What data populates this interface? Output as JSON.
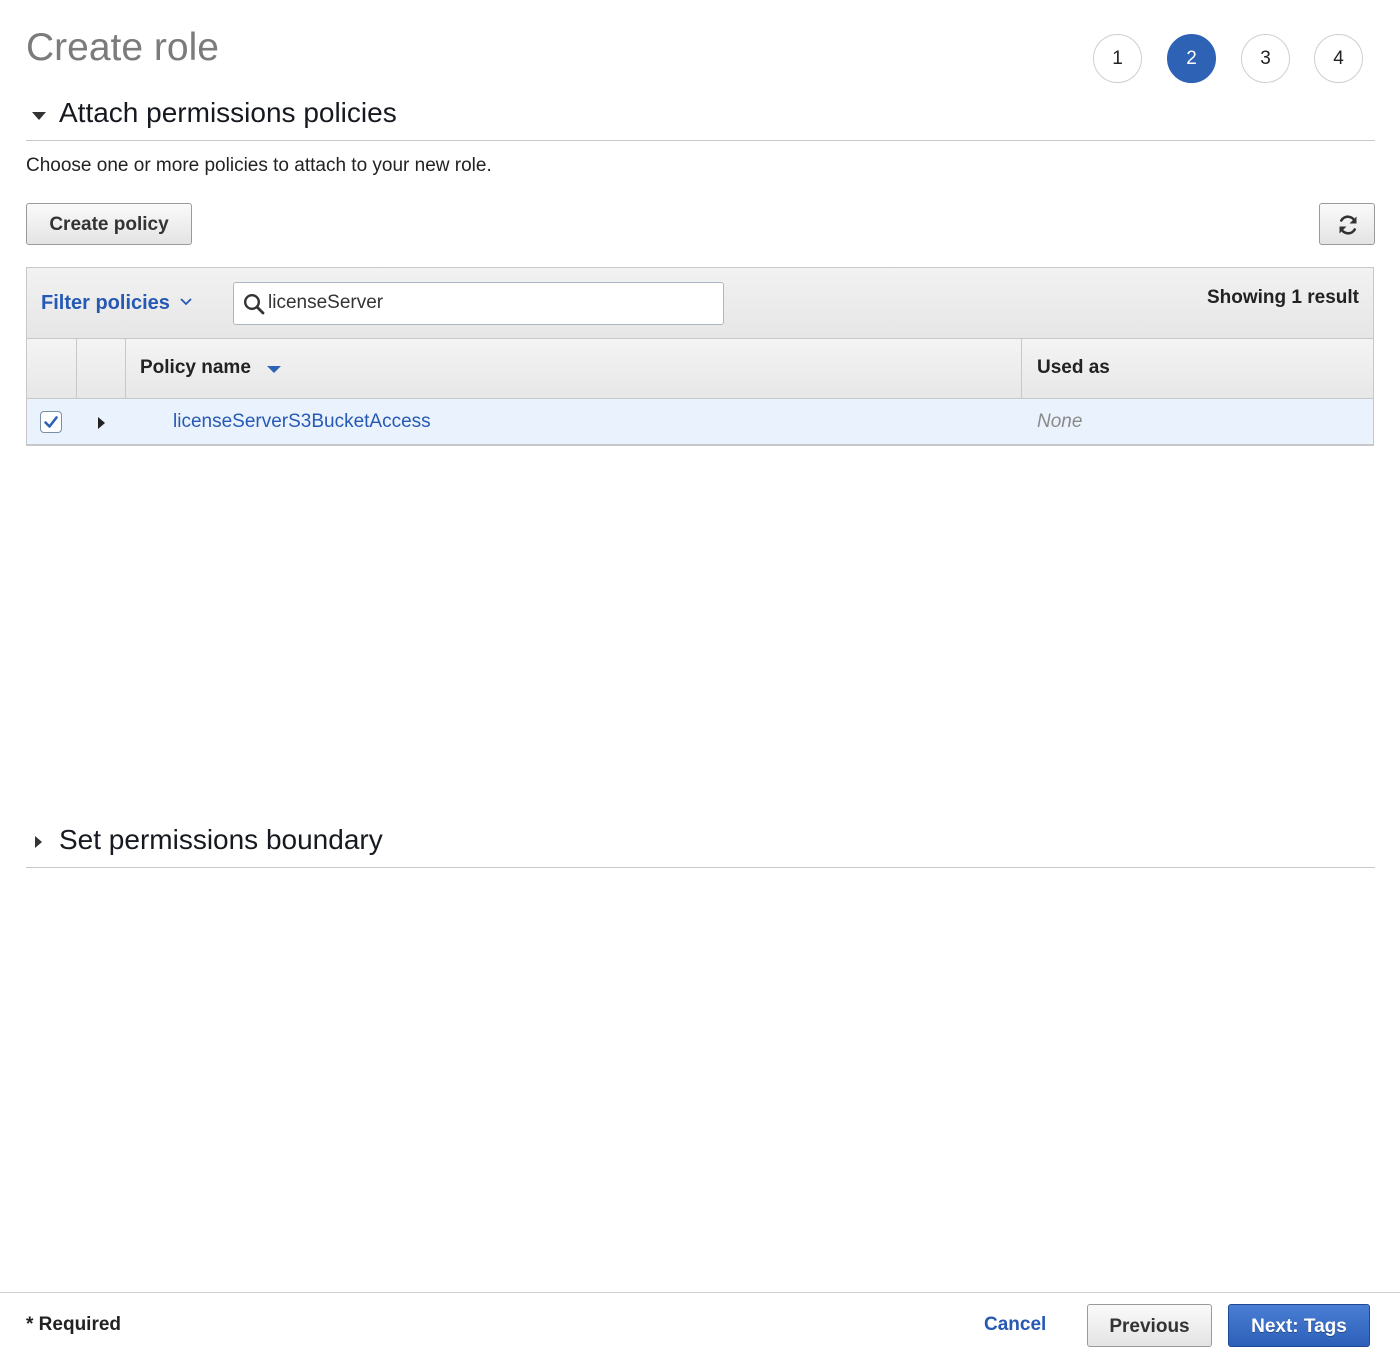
{
  "page": {
    "title": "Create role"
  },
  "steps": [
    "1",
    "2",
    "3",
    "4"
  ],
  "active_step": "2",
  "sections": {
    "attach": {
      "title": "Attach permissions policies",
      "expanded": true
    },
    "boundary": {
      "title": "Set permissions boundary",
      "expanded": false
    }
  },
  "description": "Choose one or more policies to attach to your new role.",
  "buttons": {
    "create_policy": "Create policy"
  },
  "toolbar": {
    "filter_label": "Filter policies",
    "search_value": "licenseServer",
    "result_count": "Showing 1 result"
  },
  "table": {
    "columns": [
      "Policy name",
      "Used as"
    ],
    "rows": [
      {
        "policy_name": "licenseServerS3BucketAccess",
        "used_as": "None",
        "checked": true
      }
    ]
  },
  "footer": {
    "required_note": "* Required",
    "cancel": "Cancel",
    "previous": "Previous",
    "next": "Next: Tags"
  },
  "colors": {
    "accent": "#2e62b5",
    "link": "#2659b3",
    "selected_row": "#eaf3fd"
  },
  "icons": {
    "section_expanded": "caret-down-icon",
    "section_collapsed": "caret-right-icon",
    "refresh": "refresh-icon",
    "search": "search-icon",
    "filter": "chevron-down-icon",
    "sort": "sort-down-icon",
    "row_expand": "caret-right-icon",
    "checkbox": "checkmark-icon"
  }
}
